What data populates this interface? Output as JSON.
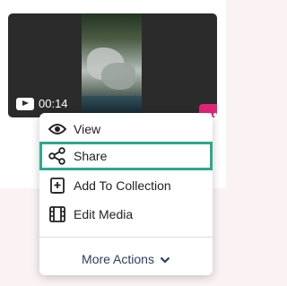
{
  "video": {
    "duration": "00:14",
    "icons": {
      "play": "video-play-icon",
      "more": "more-options-icon"
    },
    "more_button_color": "#e02478"
  },
  "menu": {
    "items": [
      {
        "label": "View",
        "icon": "eye-icon"
      },
      {
        "label": "Share",
        "icon": "share-icon",
        "focused": true
      },
      {
        "label": "Add To Collection",
        "icon": "add-collection-icon"
      },
      {
        "label": "Edit Media",
        "icon": "film-icon"
      }
    ],
    "more_actions_label": "More Actions",
    "more_actions_icon": "chevron-down-icon",
    "focus_color": "#2ea88c"
  }
}
